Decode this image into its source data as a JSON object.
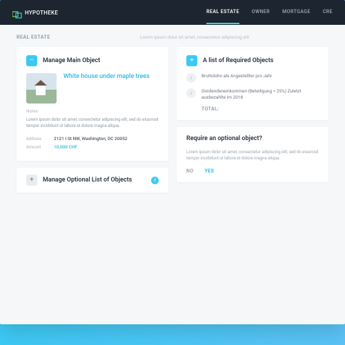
{
  "brand": {
    "name": "HYPOTHEKE"
  },
  "nav": {
    "items": [
      {
        "label": "REAL ESTATE",
        "active": true
      },
      {
        "label": "OWNER",
        "active": false
      },
      {
        "label": "MORTGAGE",
        "active": false
      },
      {
        "label": "CRE",
        "active": false
      }
    ]
  },
  "subheader": {
    "title": "REAL ESTATE",
    "desc": "Lorem ipsum dolor sit amet, consectetur adipiscing elit"
  },
  "mainObject": {
    "cardTitle": "Manage Main Object",
    "objectTitle": "White house under maple trees",
    "notesLabel": "Notes",
    "notesText": "Lorem ipsum dolor sit amet, consectetur adipiscing elit, sed do eiusmod tempor incididunt ut labore et dolore magna aliqua.",
    "addressLabel": "Address",
    "addressValue": "2121 I St NW, Washington, DC 20052",
    "amountLabel": "Amount",
    "amountValue": "10,000 CHF"
  },
  "optionalList": {
    "cardTitle": "Manage Optional List of Objects"
  },
  "requiredObjects": {
    "cardTitle": "A list of Required Objects",
    "items": [
      {
        "text": "Bruttolohn als Angestellter pro Jahr"
      },
      {
        "text": "Dividendeneinkommen (Beteiligung > 25%) Zuletzt ausbezahlte im 2018"
      }
    ],
    "totalLabel": "TOTAL:"
  },
  "optionalPrompt": {
    "title": "Require an optional object?",
    "desc": "Lorem ipsum dolor sit amet, consectetur adipiscing elit, sed do eiusmod tempor incididunt ut labore et dolore magna aliqua.",
    "no": "NO",
    "yes": "YES"
  },
  "icons": {
    "plus": "+",
    "minus": "−",
    "info": "i"
  }
}
